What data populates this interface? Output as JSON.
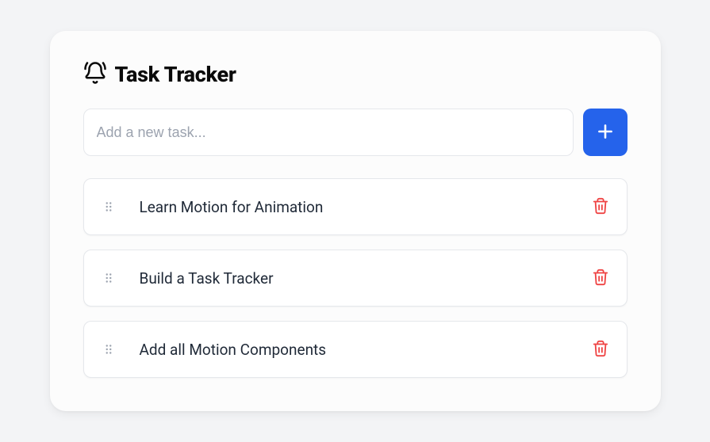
{
  "header": {
    "title": "Task Tracker"
  },
  "input": {
    "placeholder": "Add a new task...",
    "value": ""
  },
  "tasks": [
    {
      "text": "Learn Motion for Animation"
    },
    {
      "text": "Build a Task Tracker"
    },
    {
      "text": "Add all Motion Components"
    }
  ]
}
